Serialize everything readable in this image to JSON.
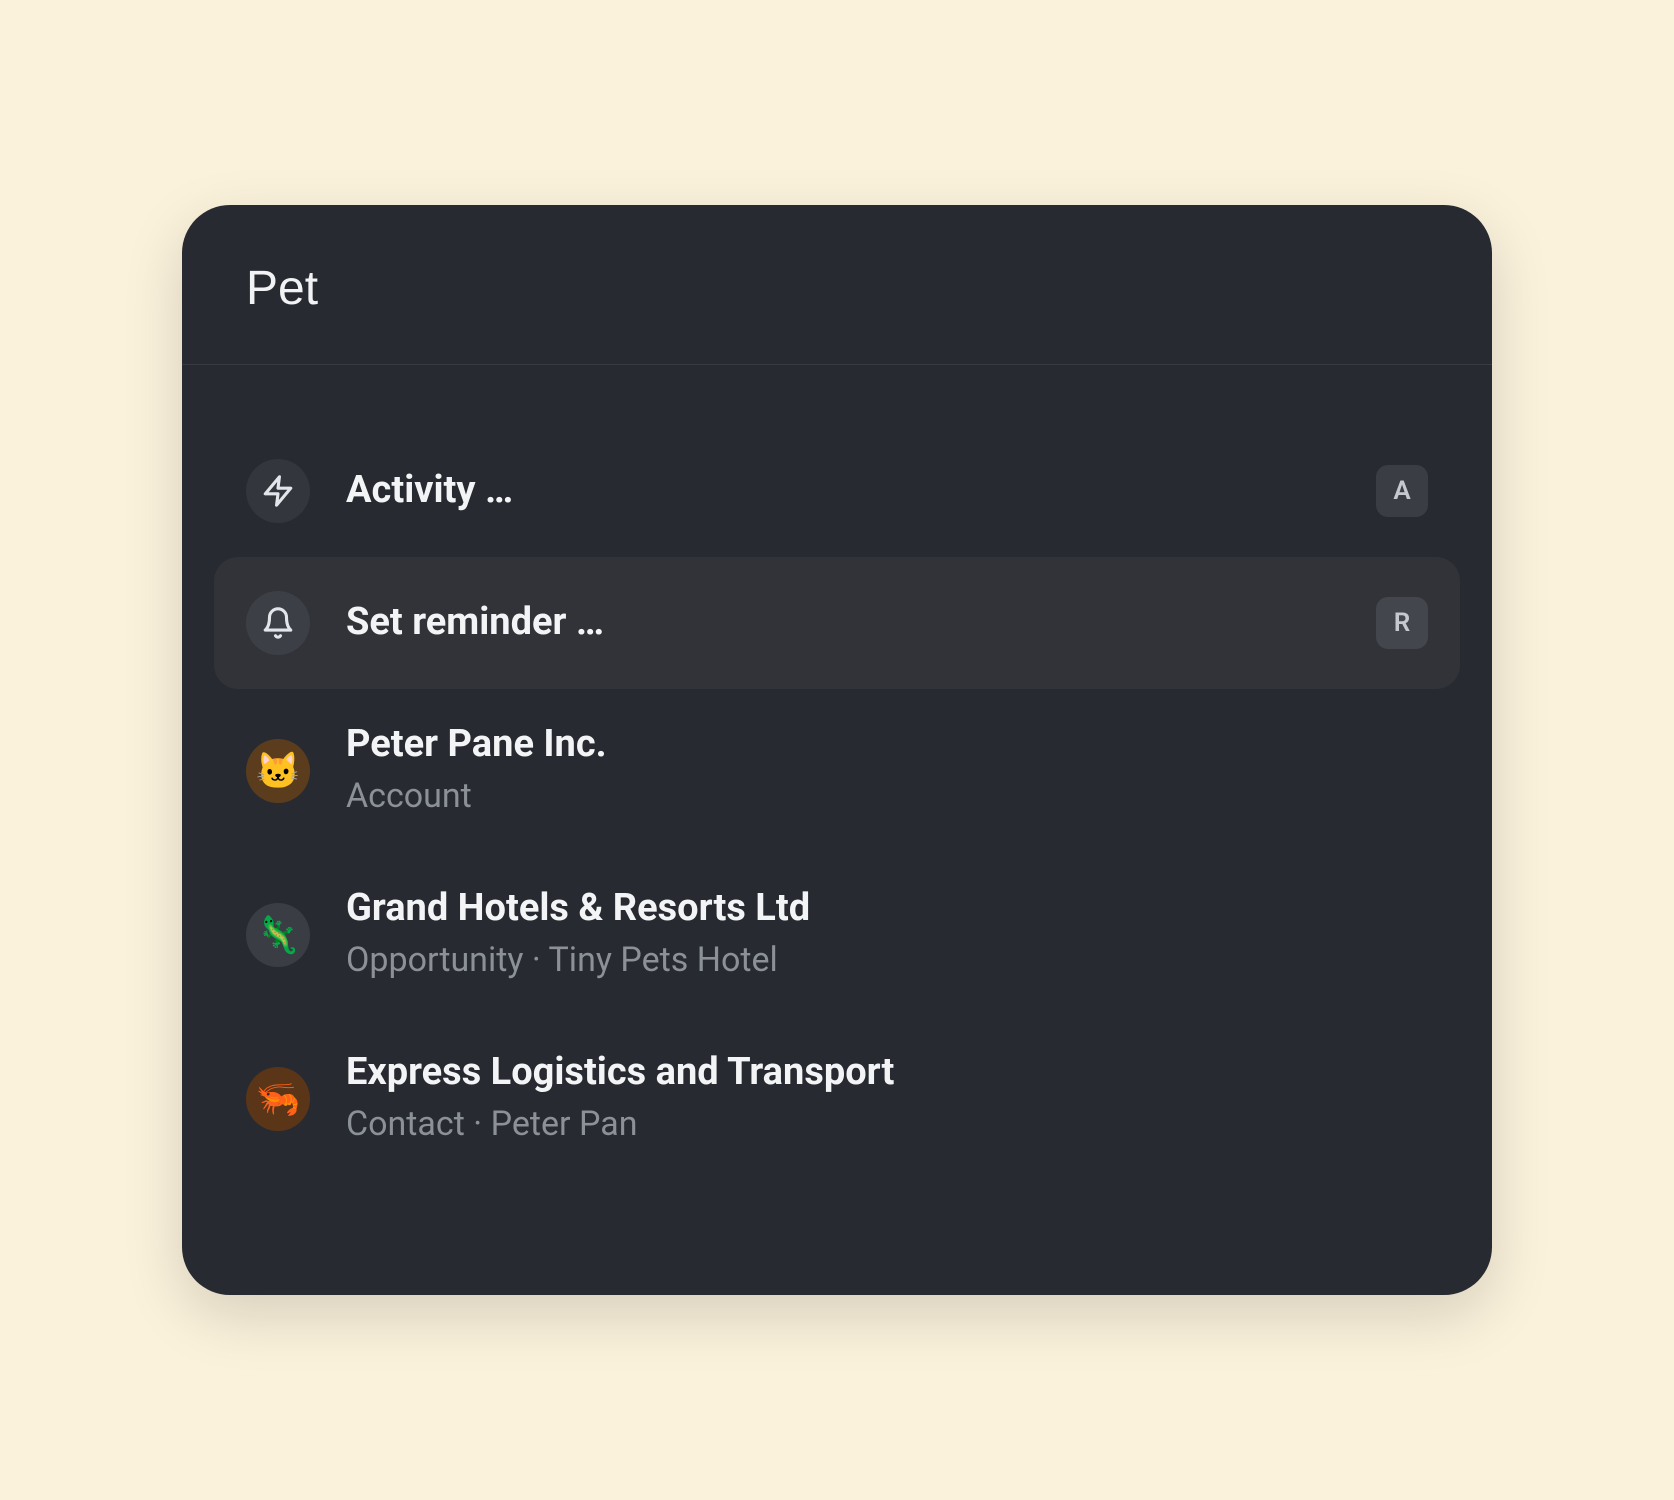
{
  "search": {
    "value": "Pet"
  },
  "commands": [
    {
      "icon": "lightning",
      "label": "Activity …",
      "shortcut": "A",
      "highlighted": false
    },
    {
      "icon": "bell",
      "label": "Set reminder …",
      "shortcut": "R",
      "highlighted": true
    }
  ],
  "results": [
    {
      "avatar_emoji": "🐱",
      "avatar_class": "orange",
      "title": "Peter Pane Inc.",
      "subtitle": "Account"
    },
    {
      "avatar_emoji": "🦎",
      "avatar_class": "grey",
      "title": "Grand Hotels & Resorts Ltd",
      "subtitle": "Opportunity · Tiny Pets Hotel"
    },
    {
      "avatar_emoji": "🦐",
      "avatar_class": "darkorange",
      "title": "Express Logistics and Transport",
      "subtitle": "Contact · Peter Pan"
    }
  ]
}
